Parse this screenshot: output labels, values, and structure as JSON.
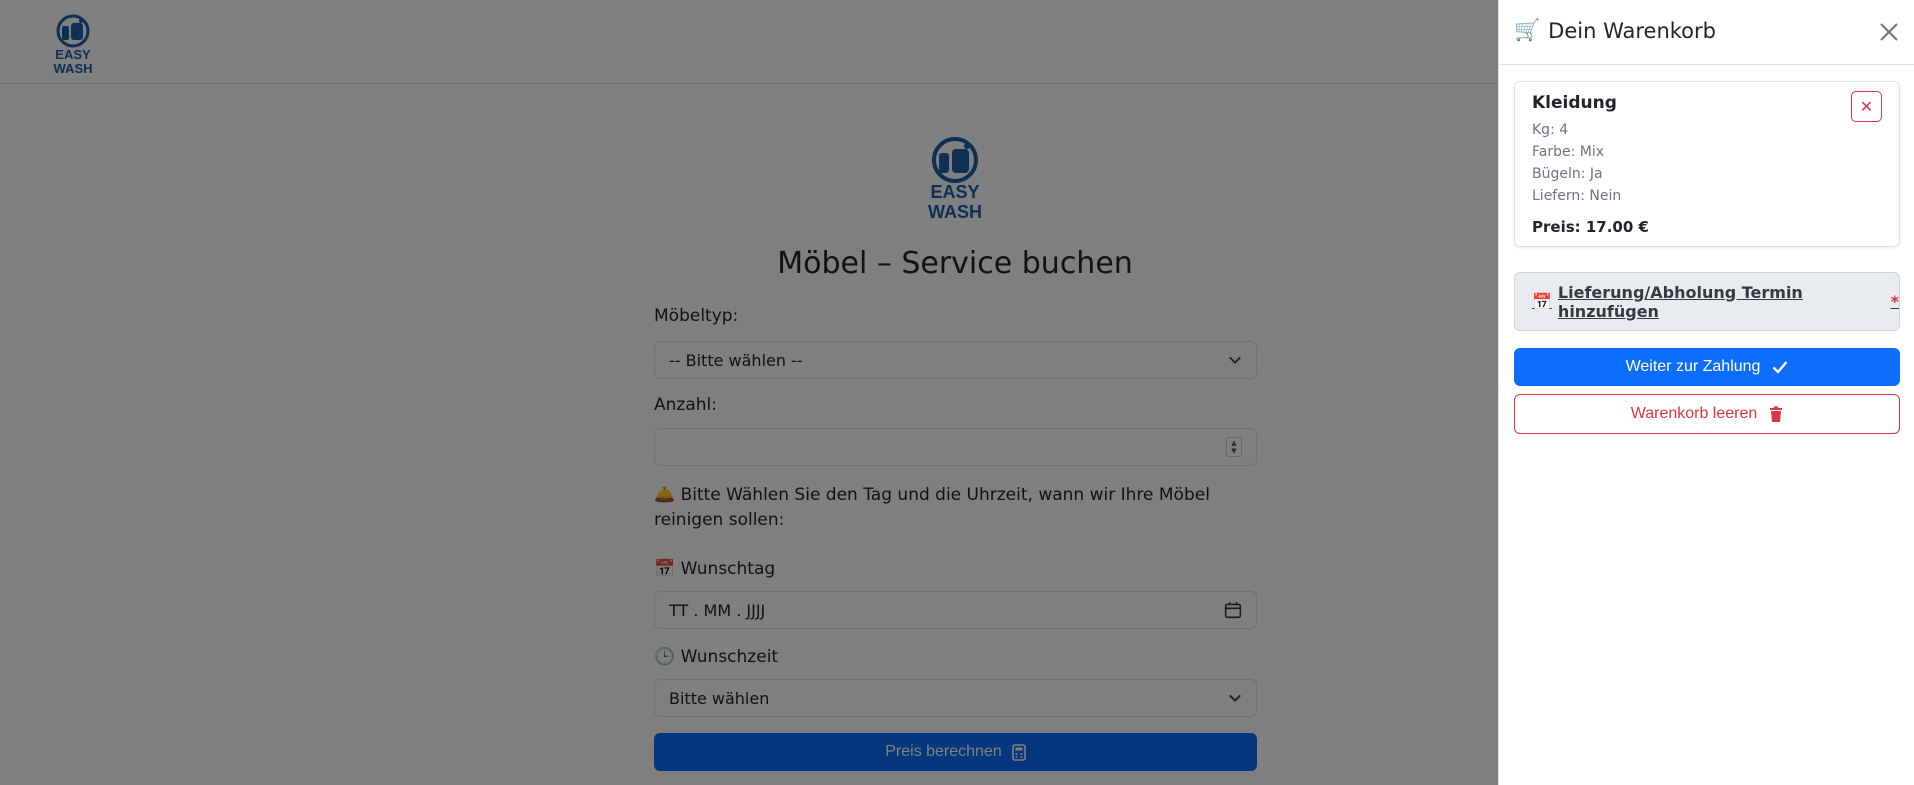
{
  "brand": {
    "logo_text_line1": "EASY",
    "logo_text_line2": "WASH",
    "color": "#1f5fa8"
  },
  "page": {
    "title": "Möbel – Service buchen",
    "moebeltyp_label": "Möbeltyp:",
    "moebeltyp_value": "-- Bitte wählen --",
    "anzahl_label": "Anzahl:",
    "anzahl_value": "",
    "hint_icon": "🛎️",
    "hint_text": "Bitte Wählen Sie den Tag und die Uhrzeit, wann wir Ihre Möbel reinigen sollen:",
    "wunschtag_icon": "📅",
    "wunschtag_label": "Wunschtag",
    "wunschtag_placeholder": "TT . MM . JJJJ",
    "wunschzeit_icon": "🕒",
    "wunschzeit_label": "Wunschzeit",
    "wunschzeit_value": "Bitte wählen",
    "calc_button": "Preis berechnen"
  },
  "cart": {
    "icon": "🛒",
    "title": "Dein Warenkorb",
    "close_icon": "close-icon",
    "item": {
      "title": "Kleidung",
      "lines": [
        "Kg: 4",
        "Farbe: Mix",
        "Bügeln: Ja",
        "Liefern: Nein"
      ],
      "price": "Preis: 17.00 €",
      "remove_symbol": "✕"
    },
    "appointment_icon": "📅",
    "appointment_link": "Lieferung/Abholung Termin hinzufügen",
    "appointment_required": "*",
    "pay_button": "Weiter zur Zahlung",
    "clear_button": "Warenkorb leeren"
  },
  "colors": {
    "primary": "#0d6efd",
    "danger": "#dc3545",
    "overlay": "rgba(0,0,0,0.5)"
  }
}
